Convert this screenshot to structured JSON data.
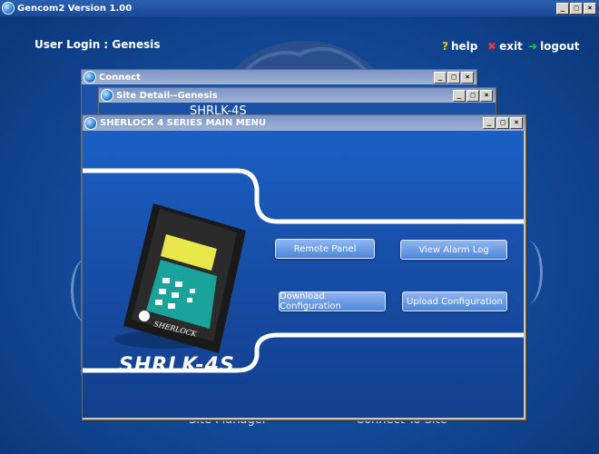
{
  "app": {
    "title": "Gencom2  Version 1.00"
  },
  "header": {
    "user_login": "User Login : Genesis",
    "help": "help",
    "exit": "exit",
    "logout": "logout"
  },
  "windows": {
    "connect": {
      "title": "Connect"
    },
    "site_detail": {
      "title": "Site Detail--Genesis",
      "peek": "SHRLK-4S"
    },
    "main_menu": {
      "title": "SHERLOCK 4 SERIES MAIN MENU"
    }
  },
  "buttons": {
    "remote_panel": "Remote  Panel",
    "view_alarm_log": "View Alarm Log",
    "download_configuration": "Download Configuration",
    "upload_configuration": "Upload Configuration"
  },
  "device": {
    "brand": "SHERLOCK",
    "label": "SHRLK-4S"
  },
  "footer": {
    "site_manager": "Site Manager",
    "connect_to_site": "Connect To Site"
  },
  "window_controls": {
    "minimize": "_",
    "maximize": "□",
    "close": "×"
  }
}
